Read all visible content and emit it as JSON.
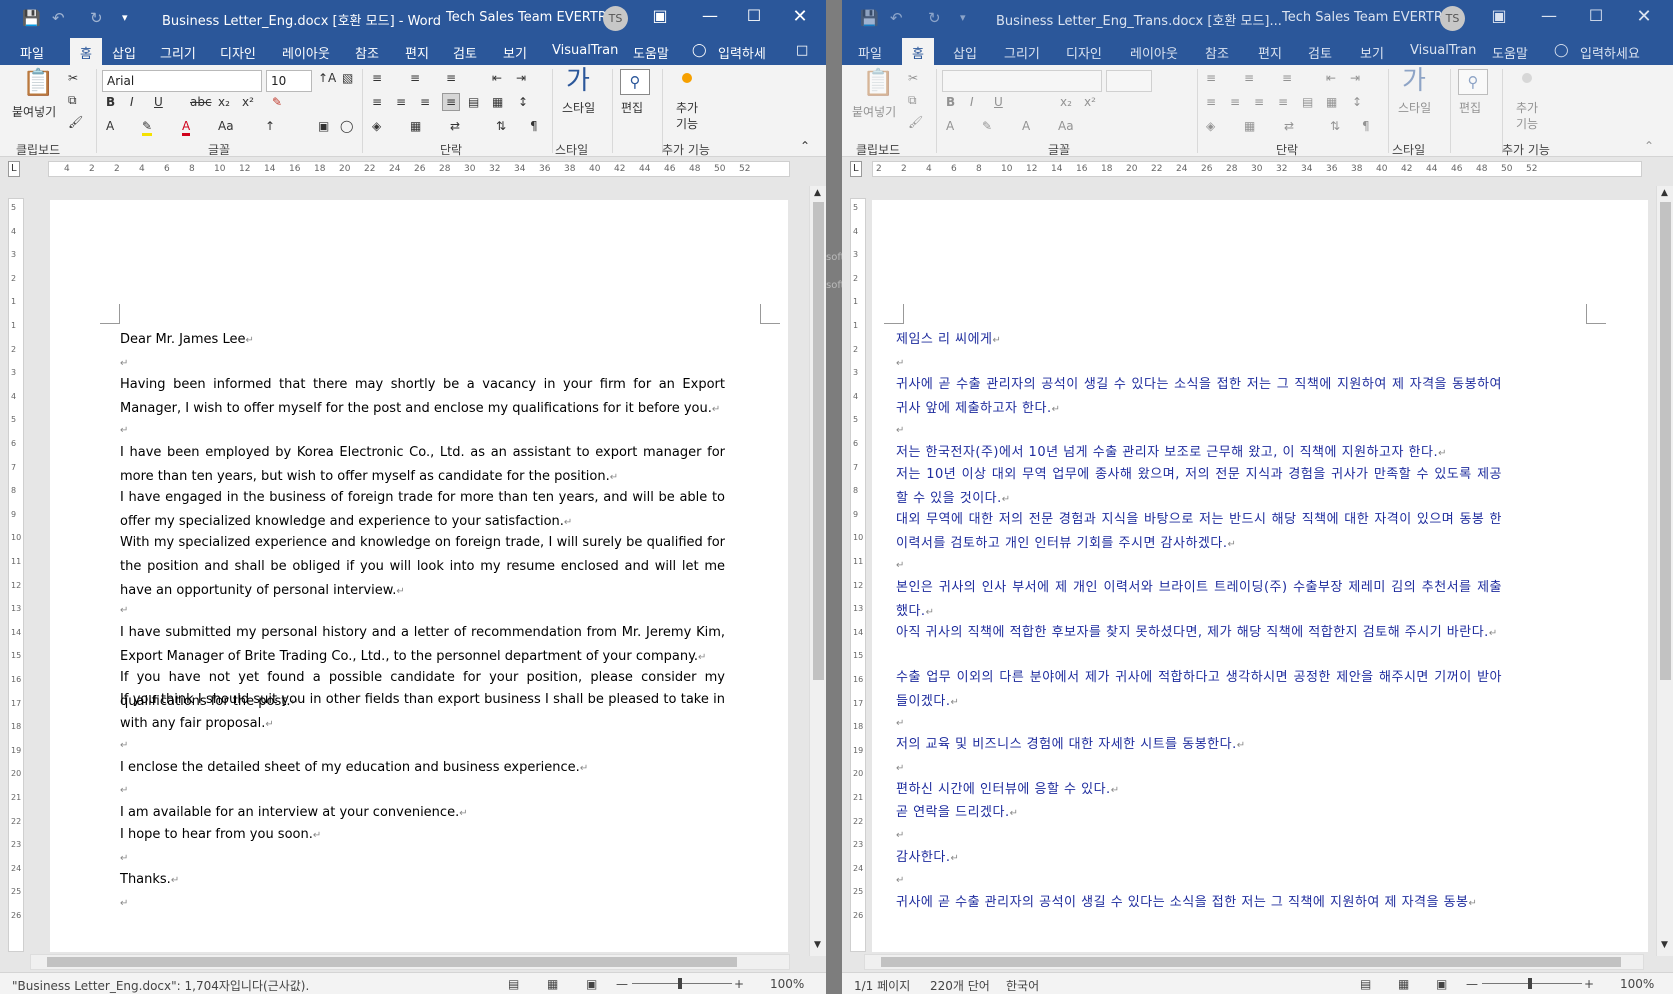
{
  "left": {
    "title": "Business Letter_Eng.docx [호환 모드]  -  Word",
    "account": "Tech Sales Team EVERTRAN",
    "avatar": "TS",
    "tabs": [
      "파일",
      "홈",
      "삽입",
      "그리기",
      "디자인",
      "레이아웃",
      "참조",
      "편지",
      "검토",
      "보기",
      "VisualTran",
      "도움말"
    ],
    "tell_me": "입력하세",
    "font_name": "Arial",
    "font_size": "10",
    "groups": {
      "clipboard": "클립보드",
      "font": "글꼴",
      "paragraph": "단락",
      "styles": "스타일",
      "addins": "추가 기능"
    },
    "buttons": {
      "paste": "붙여넣기",
      "styles": "스타일",
      "editing": "편집",
      "addins_a": "추가",
      "addins_b": "기능"
    },
    "paragraphs": [
      "Dear Mr. James Lee",
      "",
      "Having been informed that there may shortly be a vacancy in your firm for an Export Manager, I wish to offer myself for the post and enclose my qualifications for it before you.",
      "",
      "I have been employed by Korea Electronic Co., Ltd. as an assistant to export manager for more than ten years, but wish to offer myself as candidate for the position.",
      "I have engaged in the business of foreign trade for more than ten years, and will be able to offer my specialized knowledge and experience to your satisfaction.",
      "With my specialized experience and knowledge on foreign trade, I will surely be qualified for the position and shall be obliged if you will look into my resume enclosed and will let me have an opportunity of personal interview.",
      "",
      "I have submitted my personal history and a letter of recommendation from Mr. Jeremy Kim, Export Manager of Brite Trading Co., Ltd., to the personnel department of your company.",
      "If you have not yet found a possible candidate for your position, please consider my qualifications for the post.",
      "If you think I should suit you in other fields than export business I shall be pleased to take in with any fair proposal.",
      "",
      "I enclose the detailed sheet of my education and business experience.",
      "",
      "I am available for an interview at your convenience.",
      "I hope to hear from you soon.",
      "",
      "Thanks.",
      ""
    ],
    "status": {
      "words": "\"Business Letter_Eng.docx\": 1,704자입니다(근사값).",
      "zoom": "100%"
    }
  },
  "right": {
    "title": "Business Letter_Eng_Trans.docx [호환 모드]...",
    "account": "Tech Sales Team EVERTRAN",
    "avatar": "TS",
    "tabs": [
      "파일",
      "홈",
      "삽입",
      "그리기",
      "디자인",
      "레이아웃",
      "참조",
      "편지",
      "검토",
      "보기",
      "VisualTran",
      "도움말"
    ],
    "tell_me": "입력하세요",
    "groups": {
      "clipboard": "클립보드",
      "font": "글꼴",
      "paragraph": "단락",
      "styles": "스타일",
      "addins": "추가 기능"
    },
    "buttons": {
      "paste": "붙여넣기",
      "styles": "스타일",
      "editing": "편집",
      "addins_a": "추가",
      "addins_b": "기능"
    },
    "paragraphs": [
      "제임스 리 씨에게",
      "",
      "귀사에 곧 수출 관리자의 공석이 생길 수 있다는 소식을 접한 저는 그 직책에 지원하여 제 자격을 동봉하여 귀사 앞에 제출하고자 한다.",
      "",
      "저는 한국전자(주)에서 10년 넘게 수출 관리자 보조로 근무해 왔고, 이 직책에 지원하고자 한다.",
      "저는 10년 이상 대외 무역 업무에 종사해 왔으며, 저의 전문 지식과 경험을 귀사가 만족할 수 있도록 제공할 수 있을 것이다.",
      "대외 무역에 대한 저의 전문 경험과 지식을 바탕으로 저는 반드시 해당 직책에 대한 자격이 있으며 동봉 한 이력서를 검토하고 개인 인터뷰 기회를 주시면 감사하겠다.",
      "",
      "본인은 귀사의 인사 부서에 제 개인 이력서와 브라이트 트레이딩(주) 수출부장 제레미 김의 추천서를 제출했다.",
      "아직 귀사의 직책에 적합한 후보자를 찾지 못하셨다면, 제가 해당 직책에 적합한지 검토해 주시기 바란다.",
      "수출 업무 이외의 다른 분야에서 제가 귀사에 적합하다고 생각하시면 공정한 제안을 해주시면 기꺼이 받아들이겠다.",
      "",
      "저의 교육 및 비즈니스 경험에 대한 자세한 시트를 동봉한다.",
      "",
      "편하신 시간에 인터뷰에 응할 수 있다.",
      "곧 연락을 드리겠다.",
      "",
      "감사한다.",
      "",
      "귀사에 곧 수출 관리자의 공석이 생길 수 있다는 소식을 접한 저는 그 직책에 지원하여 제 자격을 동봉"
    ],
    "status": {
      "page": "1/1 페이지",
      "words": "220개 단어",
      "lang": "한국어",
      "zoom": "100%"
    }
  },
  "ruler_labels_left": [
    "4",
    "2",
    "2",
    "4",
    "6",
    "8",
    "10",
    "12",
    "14",
    "16",
    "18",
    "20",
    "22",
    "24",
    "26",
    "28",
    "30",
    "32",
    "34",
    "36",
    "38",
    "40",
    "42",
    "44",
    "46",
    "48",
    "50",
    "52"
  ],
  "ruler_labels_right": [
    "2",
    "2",
    "4",
    "6",
    "8",
    "10",
    "12",
    "14",
    "16",
    "18",
    "20",
    "22",
    "24",
    "26",
    "28",
    "30",
    "32",
    "34",
    "36",
    "38",
    "40",
    "42",
    "44",
    "46",
    "48",
    "50",
    "52"
  ],
  "vruler_labels": [
    "5",
    "4",
    "3",
    "2",
    "1",
    "1",
    "2",
    "3",
    "4",
    "5",
    "6",
    "7",
    "8",
    "9",
    "10",
    "11",
    "12",
    "13",
    "14",
    "15",
    "16",
    "17",
    "18",
    "19",
    "20",
    "21",
    "22",
    "23",
    "24",
    "25",
    "26"
  ],
  "gap_text": [
    "soft",
    "soft"
  ],
  "colors": {
    "title_bar": "#2b579a",
    "korean_text": "#1f2d9e"
  }
}
